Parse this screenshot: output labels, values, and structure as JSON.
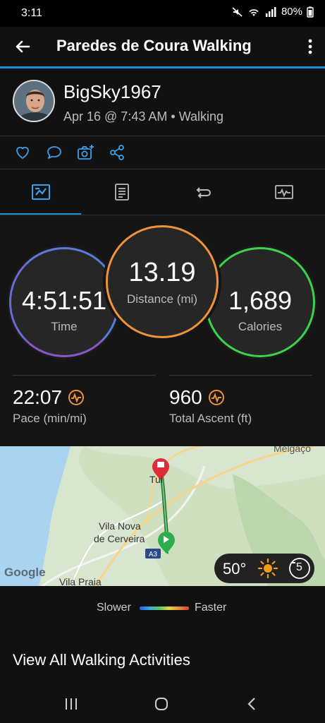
{
  "status_bar": {
    "time": "3:11",
    "battery": "80%"
  },
  "app_bar": {
    "title": "Paredes de Coura Walking"
  },
  "activity": {
    "username": "BigSky1967",
    "date": "Apr 16 @ 7:43 AM",
    "separator": "•",
    "type": "Walking"
  },
  "actions": [
    "heart-icon",
    "comment-icon",
    "add-photo-icon",
    "share-icon"
  ],
  "tabs": [
    "stats-tab",
    "details-tab",
    "laps-tab",
    "charts-tab"
  ],
  "stats": {
    "time": {
      "value": "4:51:51",
      "label": "Time"
    },
    "distance": {
      "value": "13.19",
      "label": "Distance (mi)"
    },
    "calories": {
      "value": "1,689",
      "label": "Calories"
    },
    "pace": {
      "value": "22:07",
      "label": "Pace (min/mi)"
    },
    "ascent": {
      "value": "960",
      "label": "Total Ascent (ft)"
    }
  },
  "map": {
    "labels": {
      "tui": "Tui",
      "vila_nova": "Vila Nova",
      "cerveira": "de Cerveira",
      "vila_praia": "Vila Praia",
      "melgaco": "Melgaço",
      "road": "A3",
      "google": "Google"
    },
    "weather": {
      "temp": "50°",
      "wind": "5"
    }
  },
  "legend": {
    "slower": "Slower",
    "faster": "Faster"
  },
  "view_all": "View All Walking Activities",
  "colors": {
    "accent": "#1c8fd8",
    "distance_ring": "#f0923a",
    "calories_ring": "#3bd24c",
    "time_ring": "#6b6ad0"
  }
}
